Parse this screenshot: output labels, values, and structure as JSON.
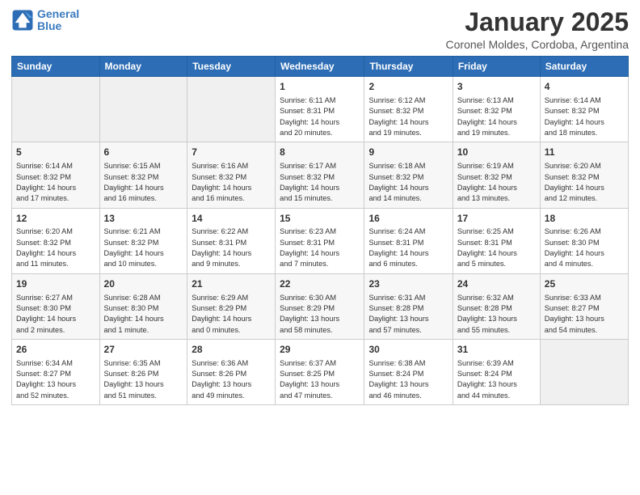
{
  "header": {
    "logo_line1": "General",
    "logo_line2": "Blue",
    "title": "January 2025",
    "subtitle": "Coronel Moldes, Cordoba, Argentina"
  },
  "weekdays": [
    "Sunday",
    "Monday",
    "Tuesday",
    "Wednesday",
    "Thursday",
    "Friday",
    "Saturday"
  ],
  "weeks": [
    [
      {
        "day": "",
        "info": ""
      },
      {
        "day": "",
        "info": ""
      },
      {
        "day": "",
        "info": ""
      },
      {
        "day": "1",
        "info": "Sunrise: 6:11 AM\nSunset: 8:31 PM\nDaylight: 14 hours\nand 20 minutes."
      },
      {
        "day": "2",
        "info": "Sunrise: 6:12 AM\nSunset: 8:32 PM\nDaylight: 14 hours\nand 19 minutes."
      },
      {
        "day": "3",
        "info": "Sunrise: 6:13 AM\nSunset: 8:32 PM\nDaylight: 14 hours\nand 19 minutes."
      },
      {
        "day": "4",
        "info": "Sunrise: 6:14 AM\nSunset: 8:32 PM\nDaylight: 14 hours\nand 18 minutes."
      }
    ],
    [
      {
        "day": "5",
        "info": "Sunrise: 6:14 AM\nSunset: 8:32 PM\nDaylight: 14 hours\nand 17 minutes."
      },
      {
        "day": "6",
        "info": "Sunrise: 6:15 AM\nSunset: 8:32 PM\nDaylight: 14 hours\nand 16 minutes."
      },
      {
        "day": "7",
        "info": "Sunrise: 6:16 AM\nSunset: 8:32 PM\nDaylight: 14 hours\nand 16 minutes."
      },
      {
        "day": "8",
        "info": "Sunrise: 6:17 AM\nSunset: 8:32 PM\nDaylight: 14 hours\nand 15 minutes."
      },
      {
        "day": "9",
        "info": "Sunrise: 6:18 AM\nSunset: 8:32 PM\nDaylight: 14 hours\nand 14 minutes."
      },
      {
        "day": "10",
        "info": "Sunrise: 6:19 AM\nSunset: 8:32 PM\nDaylight: 14 hours\nand 13 minutes."
      },
      {
        "day": "11",
        "info": "Sunrise: 6:20 AM\nSunset: 8:32 PM\nDaylight: 14 hours\nand 12 minutes."
      }
    ],
    [
      {
        "day": "12",
        "info": "Sunrise: 6:20 AM\nSunset: 8:32 PM\nDaylight: 14 hours\nand 11 minutes."
      },
      {
        "day": "13",
        "info": "Sunrise: 6:21 AM\nSunset: 8:32 PM\nDaylight: 14 hours\nand 10 minutes."
      },
      {
        "day": "14",
        "info": "Sunrise: 6:22 AM\nSunset: 8:31 PM\nDaylight: 14 hours\nand 9 minutes."
      },
      {
        "day": "15",
        "info": "Sunrise: 6:23 AM\nSunset: 8:31 PM\nDaylight: 14 hours\nand 7 minutes."
      },
      {
        "day": "16",
        "info": "Sunrise: 6:24 AM\nSunset: 8:31 PM\nDaylight: 14 hours\nand 6 minutes."
      },
      {
        "day": "17",
        "info": "Sunrise: 6:25 AM\nSunset: 8:31 PM\nDaylight: 14 hours\nand 5 minutes."
      },
      {
        "day": "18",
        "info": "Sunrise: 6:26 AM\nSunset: 8:30 PM\nDaylight: 14 hours\nand 4 minutes."
      }
    ],
    [
      {
        "day": "19",
        "info": "Sunrise: 6:27 AM\nSunset: 8:30 PM\nDaylight: 14 hours\nand 2 minutes."
      },
      {
        "day": "20",
        "info": "Sunrise: 6:28 AM\nSunset: 8:30 PM\nDaylight: 14 hours\nand 1 minute."
      },
      {
        "day": "21",
        "info": "Sunrise: 6:29 AM\nSunset: 8:29 PM\nDaylight: 14 hours\nand 0 minutes."
      },
      {
        "day": "22",
        "info": "Sunrise: 6:30 AM\nSunset: 8:29 PM\nDaylight: 13 hours\nand 58 minutes."
      },
      {
        "day": "23",
        "info": "Sunrise: 6:31 AM\nSunset: 8:28 PM\nDaylight: 13 hours\nand 57 minutes."
      },
      {
        "day": "24",
        "info": "Sunrise: 6:32 AM\nSunset: 8:28 PM\nDaylight: 13 hours\nand 55 minutes."
      },
      {
        "day": "25",
        "info": "Sunrise: 6:33 AM\nSunset: 8:27 PM\nDaylight: 13 hours\nand 54 minutes."
      }
    ],
    [
      {
        "day": "26",
        "info": "Sunrise: 6:34 AM\nSunset: 8:27 PM\nDaylight: 13 hours\nand 52 minutes."
      },
      {
        "day": "27",
        "info": "Sunrise: 6:35 AM\nSunset: 8:26 PM\nDaylight: 13 hours\nand 51 minutes."
      },
      {
        "day": "28",
        "info": "Sunrise: 6:36 AM\nSunset: 8:26 PM\nDaylight: 13 hours\nand 49 minutes."
      },
      {
        "day": "29",
        "info": "Sunrise: 6:37 AM\nSunset: 8:25 PM\nDaylight: 13 hours\nand 47 minutes."
      },
      {
        "day": "30",
        "info": "Sunrise: 6:38 AM\nSunset: 8:24 PM\nDaylight: 13 hours\nand 46 minutes."
      },
      {
        "day": "31",
        "info": "Sunrise: 6:39 AM\nSunset: 8:24 PM\nDaylight: 13 hours\nand 44 minutes."
      },
      {
        "day": "",
        "info": ""
      }
    ]
  ]
}
